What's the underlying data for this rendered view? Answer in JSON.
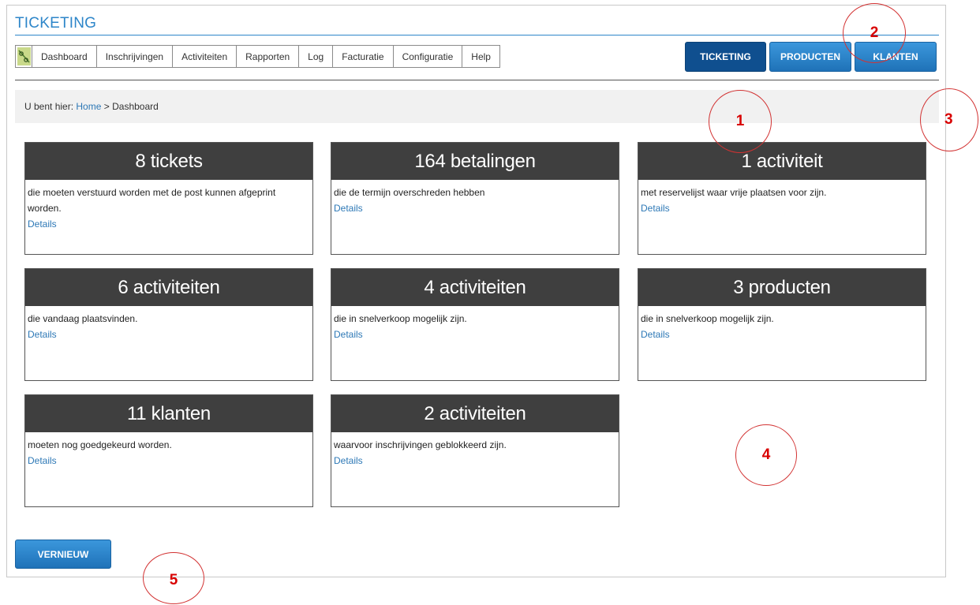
{
  "app": {
    "title": "TICKETING"
  },
  "menu": {
    "logo_icon": "app-logo-icon",
    "items": [
      {
        "label": "Dashboard"
      },
      {
        "label": "Inschrijvingen"
      },
      {
        "label": "Activiteiten"
      },
      {
        "label": "Rapporten"
      },
      {
        "label": "Log"
      },
      {
        "label": "Facturatie"
      },
      {
        "label": "Configuratie"
      },
      {
        "label": "Help"
      }
    ]
  },
  "modes": [
    {
      "label": "TICKETING",
      "active": true
    },
    {
      "label": "PRODUCTEN",
      "active": false
    },
    {
      "label": "KLANTEN",
      "active": false
    }
  ],
  "breadcrumb": {
    "prefix": "U bent hier:",
    "home": "Home",
    "separator": ">",
    "current": "Dashboard"
  },
  "cards": [
    {
      "title": "8 tickets",
      "desc": "die moeten verstuurd worden met de post kunnen afgeprint worden.",
      "link": "Details"
    },
    {
      "title": "164 betalingen",
      "desc": "die de termijn overschreden hebben",
      "link": "Details"
    },
    {
      "title": "1 activiteit",
      "desc": "met reservelijst waar vrije plaatsen voor zijn.",
      "link": "Details"
    },
    {
      "title": "6 activiteiten",
      "desc": "die vandaag plaatsvinden.",
      "link": "Details"
    },
    {
      "title": "4 activiteiten",
      "desc": "die in snelverkoop mogelijk zijn.",
      "link": "Details"
    },
    {
      "title": "3 producten",
      "desc": "die in snelverkoop mogelijk zijn.",
      "link": "Details"
    },
    {
      "title": "11 klanten",
      "desc": "moeten nog goedgekeurd worden.",
      "link": "Details"
    },
    {
      "title": "2 activiteiten",
      "desc": "waarvoor inschrijvingen geblokkeerd zijn.",
      "link": "Details"
    }
  ],
  "refresh": {
    "label": "VERNIEUW"
  },
  "callouts": [
    "1",
    "2",
    "3",
    "4",
    "5"
  ],
  "colors": {
    "accent": "#2e86c9",
    "card_header": "#3f3f3f",
    "link": "#2d78b6",
    "callout": "#d80000"
  }
}
